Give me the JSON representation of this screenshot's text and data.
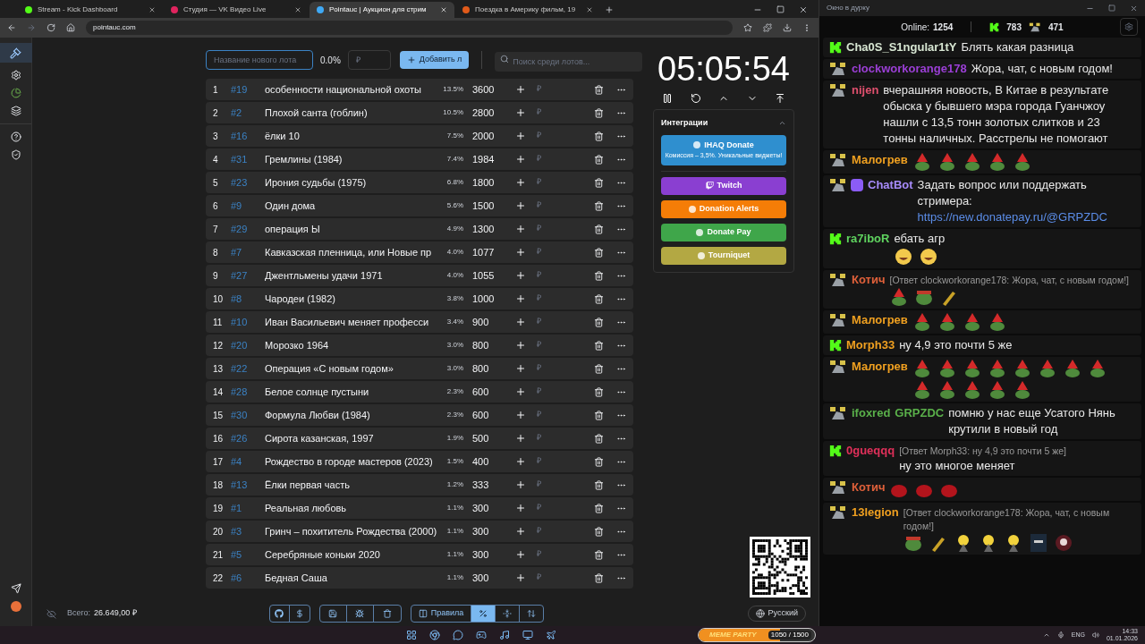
{
  "browser": {
    "tabs": [
      {
        "title": "Stream - Kick Dashboard",
        "selected": false,
        "color": "#53fc18"
      },
      {
        "title": "Студия — VK Видео Live",
        "selected": false,
        "color": "#e0245e"
      },
      {
        "title": "Pointauc | Аукцион для стрим",
        "selected": true,
        "color": "#3fa9f5"
      },
      {
        "title": "Поездка в Америку фильм, 19",
        "selected": false,
        "color": "#e05a1a"
      }
    ],
    "url": "pointauc.com"
  },
  "toolbar": {
    "lot_placeholder": "Название нового лота",
    "percent": "0.0%",
    "amount_placeholder": "₽",
    "add_label": "Добавить л",
    "search_placeholder": "Поиск среди лотов..."
  },
  "lots": [
    {
      "rank": "1",
      "id": "#19",
      "name": "особенности национальной охоты",
      "percent": "13.5%",
      "amount": "3600"
    },
    {
      "rank": "2",
      "id": "#2",
      "name": "Плохой санта (гоблин)",
      "percent": "10.5%",
      "amount": "2800"
    },
    {
      "rank": "3",
      "id": "#16",
      "name": "ёлки 10",
      "percent": "7.5%",
      "amount": "2000"
    },
    {
      "rank": "4",
      "id": "#31",
      "name": "Гремлины (1984)",
      "percent": "7.4%",
      "amount": "1984"
    },
    {
      "rank": "5",
      "id": "#23",
      "name": "Ирония судьбы (1975)",
      "percent": "6.8%",
      "amount": "1800"
    },
    {
      "rank": "6",
      "id": "#9",
      "name": "Один дома",
      "percent": "5.6%",
      "amount": "1500"
    },
    {
      "rank": "7",
      "id": "#29",
      "name": "операция Ы",
      "percent": "4.9%",
      "amount": "1300"
    },
    {
      "rank": "8",
      "id": "#7",
      "name": "Кавказская пленница, или Новые пр",
      "percent": "4.0%",
      "amount": "1077"
    },
    {
      "rank": "9",
      "id": "#27",
      "name": "Джентльмены удачи 1971",
      "percent": "4.0%",
      "amount": "1055"
    },
    {
      "rank": "10",
      "id": "#8",
      "name": "Чародеи (1982)",
      "percent": "3.8%",
      "amount": "1000"
    },
    {
      "rank": "11",
      "id": "#10",
      "name": "Иван Васильевич меняет професси",
      "percent": "3.4%",
      "amount": "900"
    },
    {
      "rank": "12",
      "id": "#20",
      "name": "Морозко 1964",
      "percent": "3.0%",
      "amount": "800"
    },
    {
      "rank": "13",
      "id": "#22",
      "name": "Операция «С новым годом»",
      "percent": "3.0%",
      "amount": "800"
    },
    {
      "rank": "14",
      "id": "#28",
      "name": "Белое солнце пустыни",
      "percent": "2.3%",
      "amount": "600"
    },
    {
      "rank": "15",
      "id": "#30",
      "name": "Формула Любви (1984)",
      "percent": "2.3%",
      "amount": "600"
    },
    {
      "rank": "16",
      "id": "#26",
      "name": "Сирота казанская, 1997",
      "percent": "1.9%",
      "amount": "500"
    },
    {
      "rank": "17",
      "id": "#4",
      "name": "Рождество в городе мастеров (2023)",
      "percent": "1.5%",
      "amount": "400"
    },
    {
      "rank": "18",
      "id": "#13",
      "name": "Ёлки первая часть",
      "percent": "1.2%",
      "amount": "333"
    },
    {
      "rank": "19",
      "id": "#1",
      "name": "Реальная любовь",
      "percent": "1.1%",
      "amount": "300"
    },
    {
      "rank": "20",
      "id": "#3",
      "name": "Гринч – похититель Рождества (2000)",
      "percent": "1.1%",
      "amount": "300"
    },
    {
      "rank": "21",
      "id": "#5",
      "name": "Серебряные коньки 2020",
      "percent": "1.1%",
      "amount": "300"
    },
    {
      "rank": "22",
      "id": "#6",
      "name": "Бедная Саша",
      "percent": "1.1%",
      "amount": "300"
    }
  ],
  "timer": "05:05:54",
  "integrations": {
    "title": "Интеграции",
    "expanded": true,
    "items": [
      {
        "label": "IHAQ Donate",
        "subtitle": "Комиссия – 3,5%. Уникальные виджеты!",
        "color": "#2f8fcf"
      },
      {
        "label": "Twitch",
        "color": "#8a3fd1"
      },
      {
        "label": "Donation Alerts",
        "color": "#f57d07"
      },
      {
        "label": "Donate Pay",
        "color": "#3fa64a"
      },
      {
        "label": "Tourniquet",
        "color": "#b3a843"
      }
    ]
  },
  "footer": {
    "total_label": "Всего:",
    "total": "26.649,00 ₽",
    "view_buttons": [
      {
        "label": "Правила",
        "selected": false
      },
      {
        "selected": true
      },
      {
        "selected": false
      },
      {
        "selected": false
      }
    ],
    "language": "Русский"
  },
  "overlay": {
    "meme_title": "MEME PARTY",
    "meme_count": "1050 / 1500",
    "level": 0.7
  },
  "chat": {
    "window_title": "Окно в дурку",
    "online_label": "Online:",
    "online": "1254",
    "kick_count": "783",
    "vk_count": "471",
    "messages": [
      {
        "kind": "kick",
        "user": "Cha0S_S1ngular1tY",
        "color": "#d7e6d2",
        "text": "Блять какая разница"
      },
      {
        "kind": "vk",
        "user": "clockworkorange178",
        "color": "#9b3fd6",
        "text": "Жора, чат, с новым годом!"
      },
      {
        "kind": "vk",
        "user": "nijen",
        "color": "#e0506e",
        "text": "вчерашняя новость, В Китае в результате обыска у бывшего мэра города Гуанчжоу нашли с 13,5 тонн золотых слитков и 23 тонны наличных. Расстрелы не помогают"
      },
      {
        "kind": "vk",
        "user": "Малогрев",
        "color": "#f0a020",
        "emotes": [
          {
            "kind": "santa"
          },
          {
            "kind": "santa"
          },
          {
            "kind": "santa"
          },
          {
            "kind": "santa"
          },
          {
            "kind": "santa"
          }
        ]
      },
      {
        "kind": "vk",
        "bot": true,
        "user": "ChatBot",
        "color": "#a78bfa",
        "text": "Задать вопрос или поддержать стримера:",
        "link": "https://new.donatepay.ru/@GRPZDC"
      },
      {
        "kind": "kick",
        "user": "ra7iboR",
        "color": "#5fd35f",
        "text": "ебать агр",
        "emotes": [
          {
            "kind": "laugh"
          },
          {
            "kind": "laugh"
          }
        ]
      },
      {
        "kind": "vk",
        "user": "Котич",
        "color": "#e0603a",
        "reply": "[Ответ clockworkorange178: Жора, чат, с новым годом!]",
        "emotes": [
          {
            "kind": "santa"
          },
          {
            "kind": "frog"
          },
          {
            "kind": "brush"
          }
        ]
      },
      {
        "kind": "vk",
        "user": "Малогрев",
        "color": "#f0a020",
        "emotes": [
          {
            "kind": "santa"
          },
          {
            "kind": "santa"
          },
          {
            "kind": "santa"
          },
          {
            "kind": "santa"
          }
        ]
      },
      {
        "kind": "kick",
        "user": "Morph33",
        "color": "#f0a020",
        "text": "ну 4,9 это почти 5 же"
      },
      {
        "kind": "vk",
        "user": "Малогрев",
        "color": "#f0a020",
        "emotes": [
          {
            "kind": "santa"
          },
          {
            "kind": "santa"
          },
          {
            "kind": "santa"
          },
          {
            "kind": "santa"
          },
          {
            "kind": "santa"
          },
          {
            "kind": "santa"
          },
          {
            "kind": "santa"
          },
          {
            "kind": "santa"
          },
          {
            "kind": "santa"
          },
          {
            "kind": "santa"
          },
          {
            "kind": "santa"
          },
          {
            "kind": "santa"
          },
          {
            "kind": "santa"
          }
        ]
      },
      {
        "kind": "vk",
        "user": "ifoxred",
        "color": "#5ab04a",
        "mention": "GRPZDC",
        "text": "помню у нас еще Усатого Нянь крутили в новый год"
      },
      {
        "kind": "kick",
        "user": "0gueqqq",
        "color": "#e0305a",
        "reply": "[Ответ Morph33: ну 4,9 это почти 5 же]",
        "text": "ну это многое меняет"
      },
      {
        "kind": "vk",
        "user": "Котич",
        "color": "#e0603a",
        "emotes": [
          {
            "kind": "bag"
          },
          {
            "kind": "bag"
          },
          {
            "kind": "bag"
          }
        ]
      },
      {
        "kind": "vk",
        "user": "13legion",
        "color": "#f0a020",
        "reply": "[Ответ clockworkorange178: Жора, чат, с новым годом!]",
        "emotes": [
          {
            "kind": "frog"
          },
          {
            "kind": "brush"
          },
          {
            "kind": "smiley"
          },
          {
            "kind": "smiley"
          },
          {
            "kind": "smiley"
          },
          {
            "kind": "hood"
          },
          {
            "kind": "skull"
          }
        ]
      }
    ]
  },
  "taskbar": {
    "language": "ENG",
    "time": "14:33",
    "date": "01.01.2026"
  }
}
